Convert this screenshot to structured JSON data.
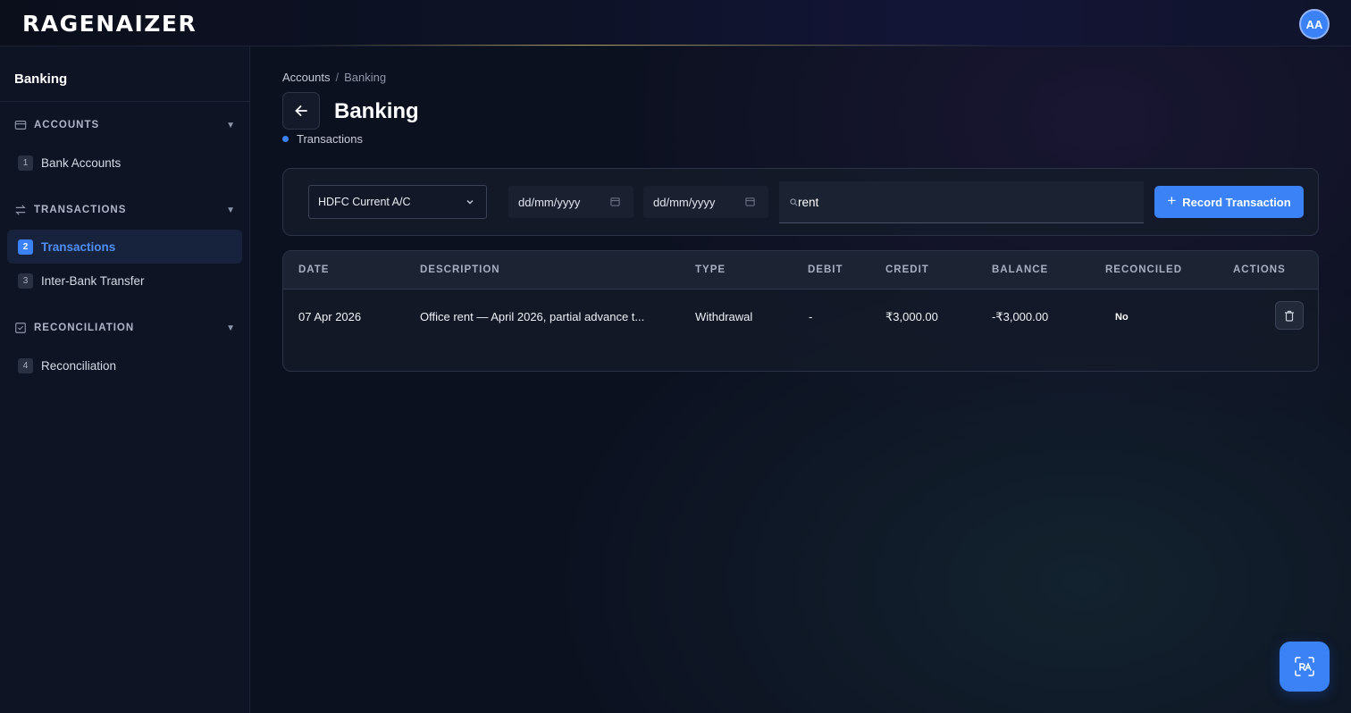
{
  "header": {
    "logo_text": "RAGENAIZER",
    "avatar_initials": "AA"
  },
  "sidebar": {
    "title": "Banking",
    "sections": [
      {
        "label": "ACCOUNTS",
        "icon": "card-icon",
        "items": [
          {
            "num": "1",
            "label": "Bank Accounts"
          }
        ]
      },
      {
        "label": "TRANSACTIONS",
        "icon": "swap-icon",
        "items": [
          {
            "num": "2",
            "label": "Transactions",
            "active": true
          },
          {
            "num": "3",
            "label": "Inter-Bank Transfer"
          }
        ]
      },
      {
        "label": "RECONCILIATION",
        "icon": "check-square-icon",
        "items": [
          {
            "num": "4",
            "label": "Reconciliation"
          }
        ]
      }
    ],
    "caret": "▼"
  },
  "breadcrumb": {
    "root": "Accounts",
    "sep": "/",
    "current": "Banking"
  },
  "page": {
    "title": "Banking",
    "subtab": "Transactions"
  },
  "filters": {
    "account_selected": "HDFC Current A/C",
    "from_date_placeholder": "dd/mm/yyyy",
    "to_date_placeholder": "dd/mm/yyyy",
    "search_value": "rent",
    "record_label": "Record Transaction",
    "record_plus": "+"
  },
  "table": {
    "headers": [
      "DATE",
      "DESCRIPTION",
      "TYPE",
      "DEBIT",
      "CREDIT",
      "BALANCE",
      "RECONCILED",
      "ACTIONS"
    ],
    "rows": [
      {
        "date": "07 Apr 2026",
        "description": "Office rent — April 2026, partial advance t...",
        "type": "Withdrawal",
        "debit": "-",
        "credit": "₹3,000.00",
        "balance": "-₹3,000.00",
        "reconciled": "No"
      }
    ]
  },
  "colors": {
    "accent": "#3b82f6",
    "background": "#0c1120",
    "panel": "#0e1424"
  }
}
